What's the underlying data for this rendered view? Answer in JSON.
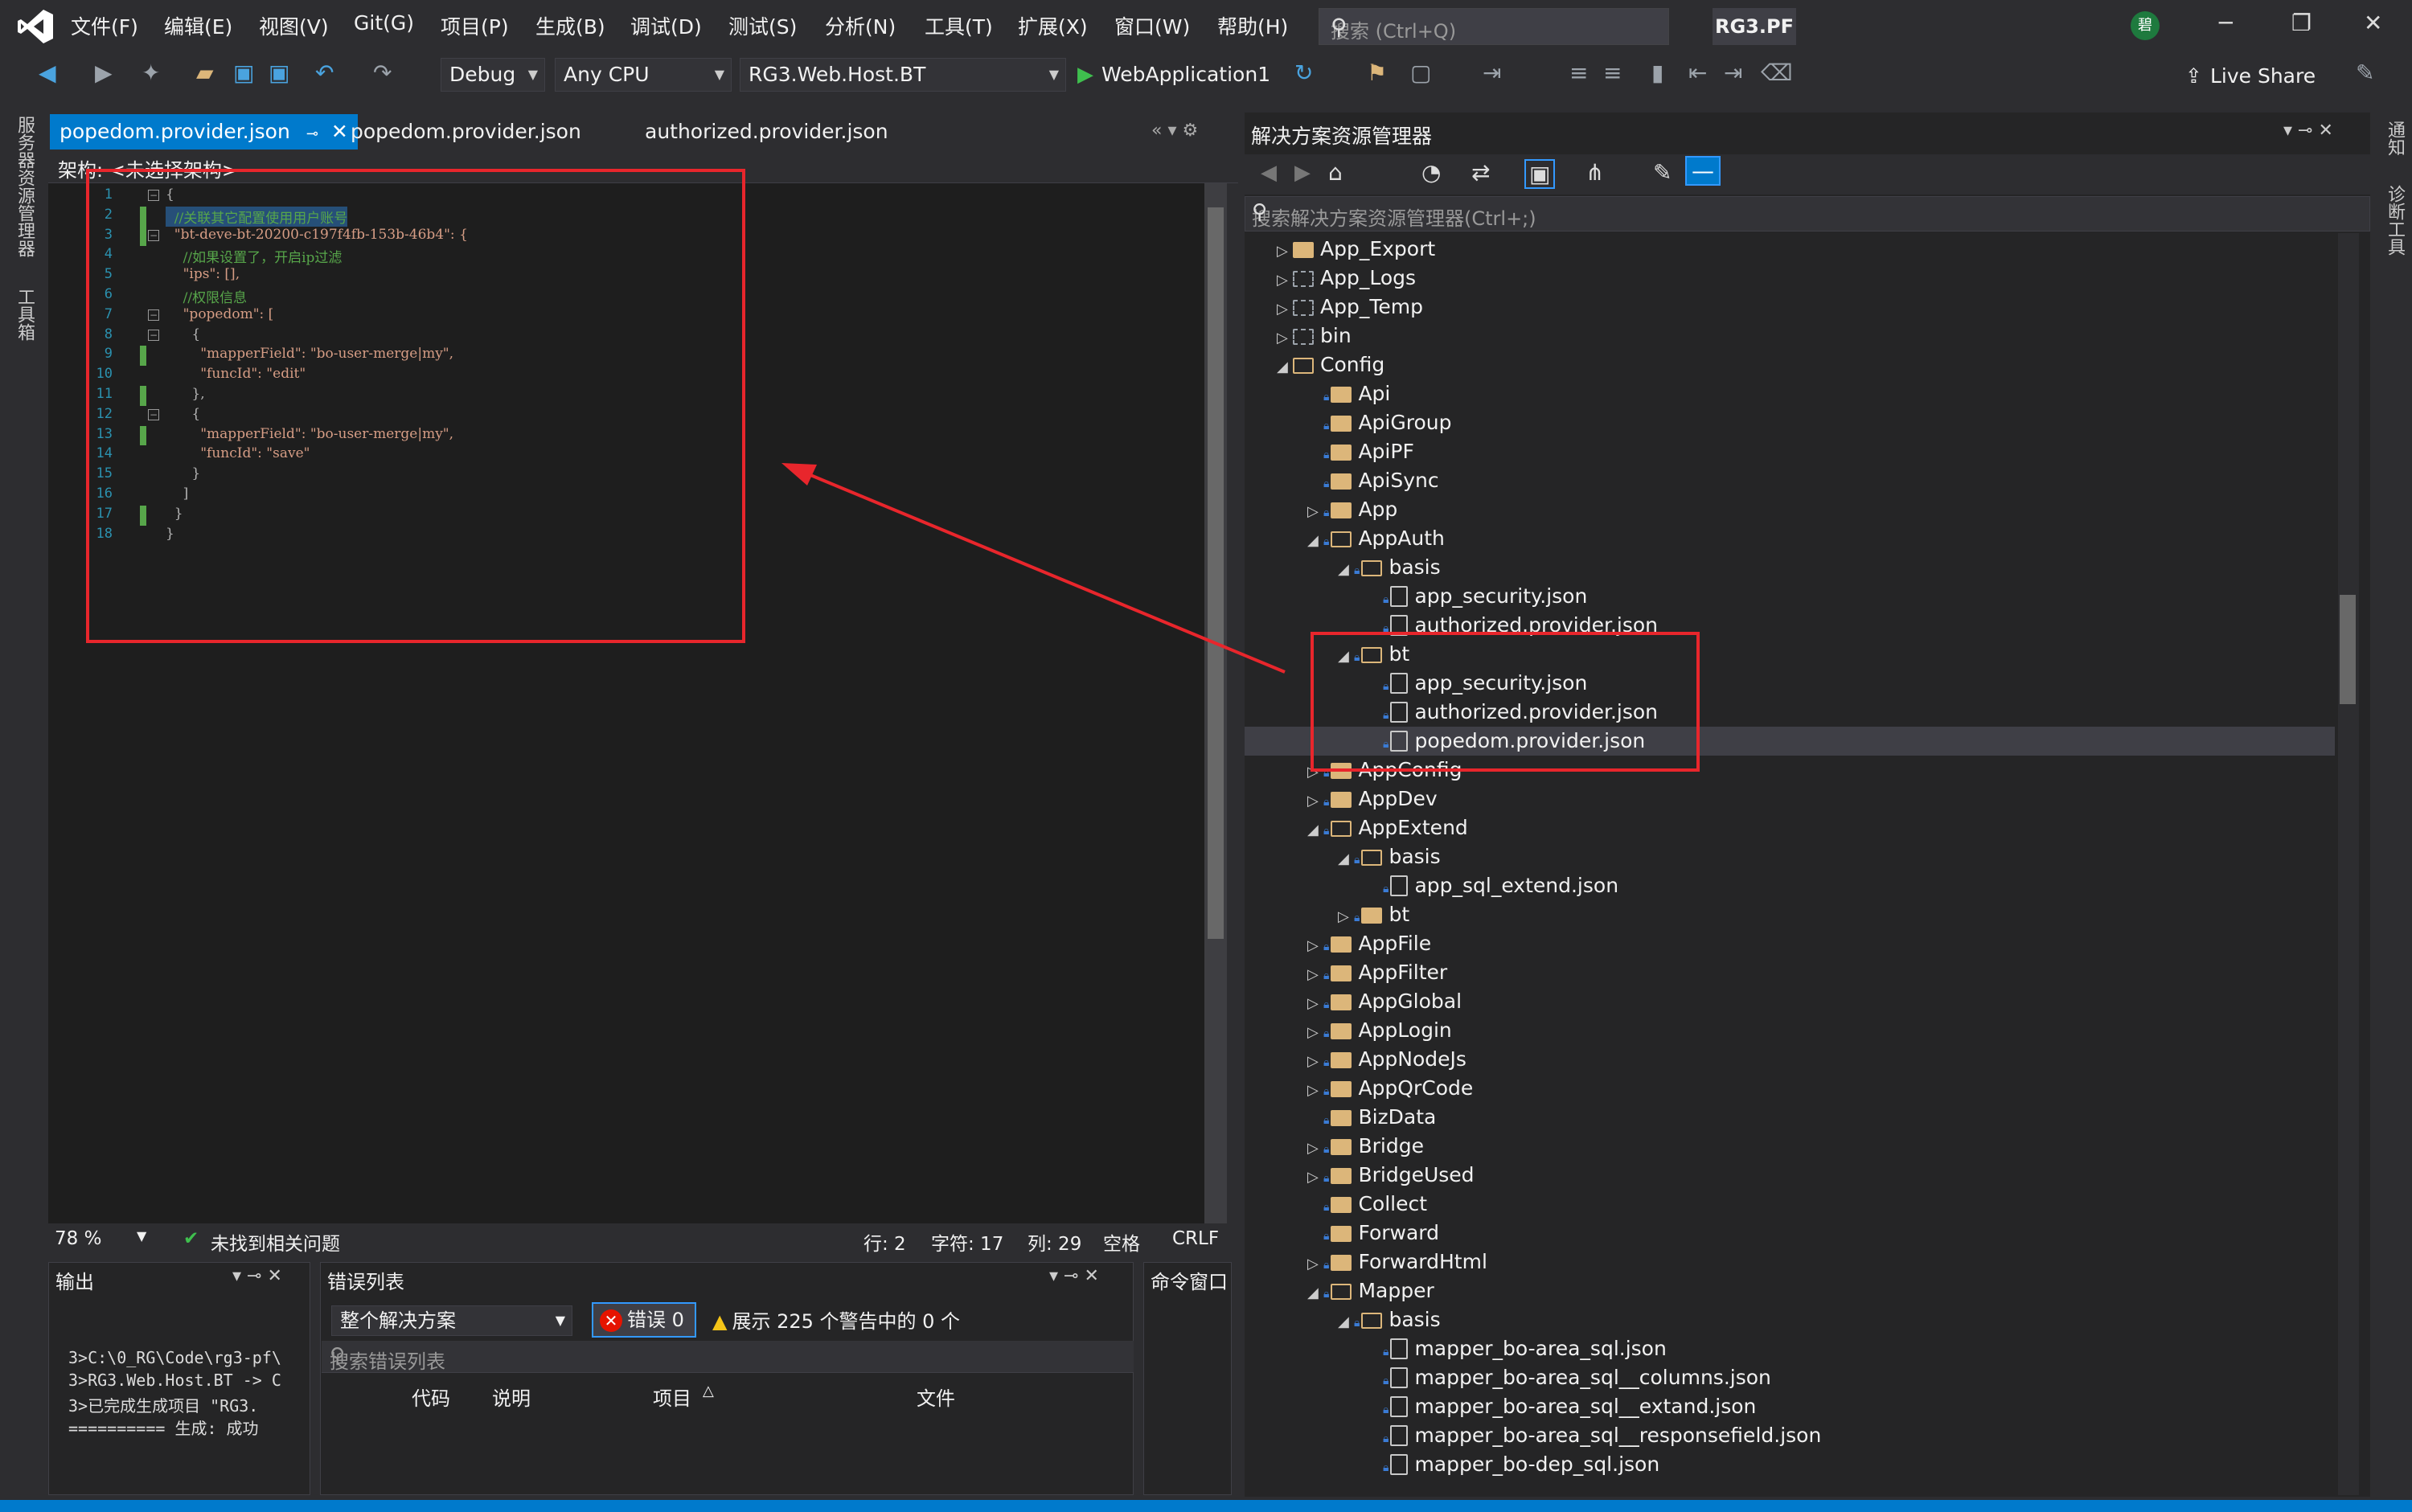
{
  "menu": [
    "文件(F)",
    "编辑(E)",
    "视图(V)",
    "Git(G)",
    "项目(P)",
    "生成(B)",
    "调试(D)",
    "测试(S)",
    "分析(N)",
    "工具(T)",
    "扩展(X)",
    "窗口(W)",
    "帮助(H)"
  ],
  "search": {
    "placeholder": "搜索 (Ctrl+Q)"
  },
  "app_name": "RG3.PF",
  "avatar": "碧",
  "toolbar": {
    "config": "Debug",
    "platform": "Any CPU",
    "project": "RG3.Web.Host.BT",
    "run": "WebApplication1",
    "liveshare": "Live Share"
  },
  "left_strip": [
    "服务器资源管理器",
    "工具箱"
  ],
  "right_strip": [
    "通知",
    "诊断工具"
  ],
  "tabs": [
    "popedom.provider.json",
    "popedom.provider.json",
    "authorized.provider.json"
  ],
  "nav_bar": "架构: <未选择架构>",
  "code_lines": [
    {
      "n": "1",
      "t": "{"
    },
    {
      "n": "2",
      "t": "  //关联其它配置使用用户账号"
    },
    {
      "n": "3",
      "t": "  \"bt-deve-bt-20200-c197f4fb-153b-46b4\": {"
    },
    {
      "n": "4",
      "t": "    //如果设置了，开启ip过滤"
    },
    {
      "n": "5",
      "t": "    \"ips\": [],"
    },
    {
      "n": "6",
      "t": "    //权限信息"
    },
    {
      "n": "7",
      "t": "    \"popedom\": ["
    },
    {
      "n": "8",
      "t": "      {"
    },
    {
      "n": "9",
      "t": "        \"mapperField\": \"bo-user-merge|my\","
    },
    {
      "n": "10",
      "t": "        \"funcId\": \"edit\""
    },
    {
      "n": "11",
      "t": "      },"
    },
    {
      "n": "12",
      "t": "      {"
    },
    {
      "n": "13",
      "t": "        \"mapperField\": \"bo-user-merge|my\","
    },
    {
      "n": "14",
      "t": "        \"funcId\": \"save\""
    },
    {
      "n": "15",
      "t": "      }"
    },
    {
      "n": "16",
      "t": "    ]"
    },
    {
      "n": "17",
      "t": "  }"
    },
    {
      "n": "18",
      "t": "}"
    }
  ],
  "editor_status": {
    "zoom": "78 %",
    "issues": "未找到相关问题",
    "line": "行: 2",
    "char": "字符: 17",
    "col": "列: 29",
    "space": "空格",
    "eol": "CRLF"
  },
  "output": {
    "title": "输出",
    "lines": [
      "3>C:\\0_RG\\Code\\rg3-pf\\",
      "3>RG3.Web.Host.BT -> C",
      "3>已完成生成项目 \"RG3.",
      "========== 生成: 成功"
    ]
  },
  "errors": {
    "title": "错误列表",
    "scope": "整个解决方案",
    "errors": "错误 0",
    "warnings": "展示 225 个警告中的 0 个",
    "search": "搜索错误列表",
    "cols": [
      "代码",
      "说明",
      "项目",
      "文件"
    ]
  },
  "command": {
    "title": "命令窗口"
  },
  "solution": {
    "title": "解决方案资源管理器",
    "search": "搜索解决方案资源管理器(Ctrl+;)",
    "items": [
      {
        "label": "App_Export",
        "type": "folder",
        "level": 0,
        "arrow": "▷"
      },
      {
        "label": "App_Logs",
        "type": "dashed",
        "level": 0,
        "arrow": "▷"
      },
      {
        "label": "App_Temp",
        "type": "dashed",
        "level": 0,
        "arrow": "▷"
      },
      {
        "label": "bin",
        "type": "dashed",
        "level": 0,
        "arrow": "▷"
      },
      {
        "label": "Config",
        "type": "open",
        "level": 0,
        "arrow": "◢"
      },
      {
        "label": "Api",
        "type": "folder",
        "level": 1,
        "arrow": ""
      },
      {
        "label": "ApiGroup",
        "type": "folder",
        "level": 1,
        "arrow": ""
      },
      {
        "label": "ApiPF",
        "type": "folder",
        "level": 1,
        "arrow": ""
      },
      {
        "label": "ApiSync",
        "type": "folder",
        "level": 1,
        "arrow": ""
      },
      {
        "label": "App",
        "type": "folder",
        "level": 1,
        "arrow": "▷"
      },
      {
        "label": "AppAuth",
        "type": "open",
        "level": 1,
        "arrow": "◢"
      },
      {
        "label": "basis",
        "type": "open",
        "level": 2,
        "arrow": "◢"
      },
      {
        "label": "app_security.json",
        "type": "file",
        "level": 3,
        "arrow": ""
      },
      {
        "label": "authorized.provider.json",
        "type": "file",
        "level": 3,
        "arrow": ""
      },
      {
        "label": "bt",
        "type": "open",
        "level": 2,
        "arrow": "◢"
      },
      {
        "label": "app_security.json",
        "type": "file",
        "level": 3,
        "arrow": ""
      },
      {
        "label": "authorized.provider.json",
        "type": "file",
        "level": 3,
        "arrow": ""
      },
      {
        "label": "popedom.provider.json",
        "type": "file",
        "level": 3,
        "arrow": "",
        "selected": true
      },
      {
        "label": "AppConfig",
        "type": "folder",
        "level": 1,
        "arrow": "▷"
      },
      {
        "label": "AppDev",
        "type": "folder",
        "level": 1,
        "arrow": "▷"
      },
      {
        "label": "AppExtend",
        "type": "open",
        "level": 1,
        "arrow": "◢"
      },
      {
        "label": "basis",
        "type": "open",
        "level": 2,
        "arrow": "◢"
      },
      {
        "label": "app_sql_extend.json",
        "type": "file",
        "level": 3,
        "arrow": ""
      },
      {
        "label": "bt",
        "type": "folder",
        "level": 2,
        "arrow": "▷"
      },
      {
        "label": "AppFile",
        "type": "folder",
        "level": 1,
        "arrow": "▷"
      },
      {
        "label": "AppFilter",
        "type": "folder",
        "level": 1,
        "arrow": "▷"
      },
      {
        "label": "AppGlobal",
        "type": "folder",
        "level": 1,
        "arrow": "▷"
      },
      {
        "label": "AppLogin",
        "type": "folder",
        "level": 1,
        "arrow": "▷"
      },
      {
        "label": "AppNodeJs",
        "type": "folder",
        "level": 1,
        "arrow": "▷"
      },
      {
        "label": "AppQrCode",
        "type": "folder",
        "level": 1,
        "arrow": "▷"
      },
      {
        "label": "BizData",
        "type": "folder",
        "level": 1,
        "arrow": ""
      },
      {
        "label": "Bridge",
        "type": "folder",
        "level": 1,
        "arrow": "▷"
      },
      {
        "label": "BridgeUsed",
        "type": "folder",
        "level": 1,
        "arrow": "▷"
      },
      {
        "label": "Collect",
        "type": "folder",
        "level": 1,
        "arrow": ""
      },
      {
        "label": "Forward",
        "type": "folder",
        "level": 1,
        "arrow": ""
      },
      {
        "label": "ForwardHtml",
        "type": "folder",
        "level": 1,
        "arrow": "▷"
      },
      {
        "label": "Mapper",
        "type": "open",
        "level": 1,
        "arrow": "◢"
      },
      {
        "label": "basis",
        "type": "open",
        "level": 2,
        "arrow": "◢"
      },
      {
        "label": "mapper_bo-area_sql.json",
        "type": "file",
        "level": 3,
        "arrow": ""
      },
      {
        "label": "mapper_bo-area_sql__columns.json",
        "type": "file",
        "level": 3,
        "arrow": ""
      },
      {
        "label": "mapper_bo-area_sql__extand.json",
        "type": "file",
        "level": 3,
        "arrow": ""
      },
      {
        "label": "mapper_bo-area_sql__responsefield.json",
        "type": "file",
        "level": 3,
        "arrow": ""
      },
      {
        "label": "mapper_bo-dep_sql.json",
        "type": "file",
        "level": 3,
        "arrow": ""
      }
    ]
  },
  "colors": {
    "accent": "#007acc",
    "annotation": "#e8262c",
    "bg": "#2d2d30",
    "editor_bg": "#1e1e1e"
  }
}
